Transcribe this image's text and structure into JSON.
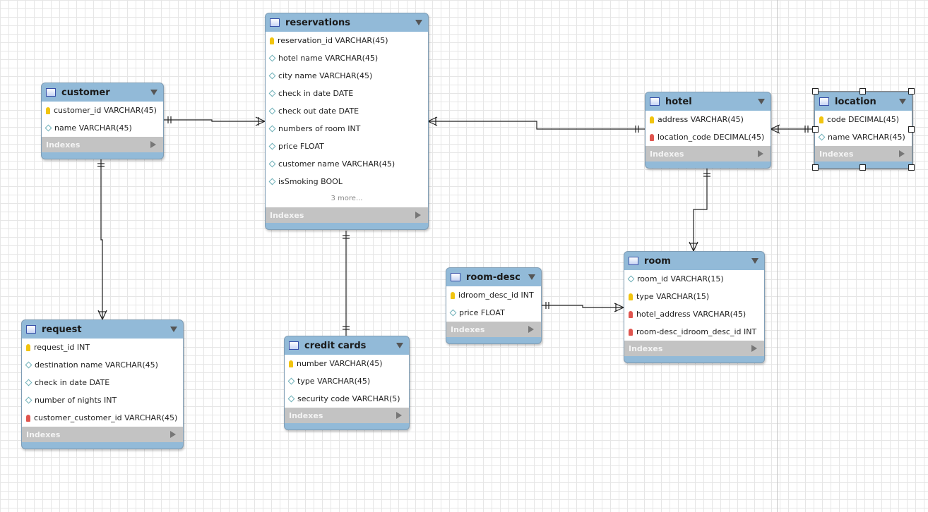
{
  "tables": {
    "customer": {
      "name": "customer",
      "cols": [
        {
          "k": "pk",
          "t": "customer_id VARCHAR(45)"
        },
        {
          "k": "",
          "t": "name VARCHAR(45)"
        }
      ],
      "indexes": "Indexes"
    },
    "reservations": {
      "name": "reservations",
      "cols": [
        {
          "k": "pk",
          "t": "reservation_id VARCHAR(45)"
        },
        {
          "k": "",
          "t": "hotel name VARCHAR(45)"
        },
        {
          "k": "",
          "t": "city name VARCHAR(45)"
        },
        {
          "k": "",
          "t": "check in date DATE"
        },
        {
          "k": "",
          "t": "check out date DATE"
        },
        {
          "k": "",
          "t": "numbers of room INT"
        },
        {
          "k": "",
          "t": "price FLOAT"
        },
        {
          "k": "",
          "t": "customer name VARCHAR(45)"
        },
        {
          "k": "",
          "t": "isSmoking BOOL"
        }
      ],
      "more": "3 more...",
      "indexes": "Indexes"
    },
    "hotel": {
      "name": "hotel",
      "cols": [
        {
          "k": "pk",
          "t": "address VARCHAR(45)"
        },
        {
          "k": "fk",
          "t": "location_code DECIMAL(45)"
        }
      ],
      "indexes": "Indexes"
    },
    "location": {
      "name": "location",
      "cols": [
        {
          "k": "pk",
          "t": "code DECIMAL(45)"
        },
        {
          "k": "",
          "t": "name VARCHAR(45)"
        }
      ],
      "indexes": "Indexes"
    },
    "room": {
      "name": "room",
      "cols": [
        {
          "k": "",
          "t": "room_id VARCHAR(15)"
        },
        {
          "k": "pk",
          "t": "type VARCHAR(15)"
        },
        {
          "k": "fk",
          "t": "hotel_address VARCHAR(45)"
        },
        {
          "k": "fk",
          "t": "room-desc_idroom_desc_id INT"
        }
      ],
      "indexes": "Indexes"
    },
    "room_desc": {
      "name": "room-desc",
      "cols": [
        {
          "k": "pk",
          "t": "idroom_desc_id INT"
        },
        {
          "k": "",
          "t": "price FLOAT"
        }
      ],
      "indexes": "Indexes"
    },
    "request": {
      "name": "request",
      "cols": [
        {
          "k": "pk",
          "t": "request_id INT"
        },
        {
          "k": "",
          "t": "destination name VARCHAR(45)"
        },
        {
          "k": "",
          "t": "check in date DATE"
        },
        {
          "k": "",
          "t": "number of nights INT"
        },
        {
          "k": "fk",
          "t": "customer_customer_id VARCHAR(45)"
        }
      ],
      "indexes": "Indexes"
    },
    "credit_cards": {
      "name": "credit cards",
      "cols": [
        {
          "k": "pk",
          "t": "number VARCHAR(45)"
        },
        {
          "k": "",
          "t": "type VARCHAR(45)"
        },
        {
          "k": "",
          "t": "security code VARCHAR(5)"
        }
      ],
      "indexes": "Indexes"
    }
  },
  "selected": "location"
}
